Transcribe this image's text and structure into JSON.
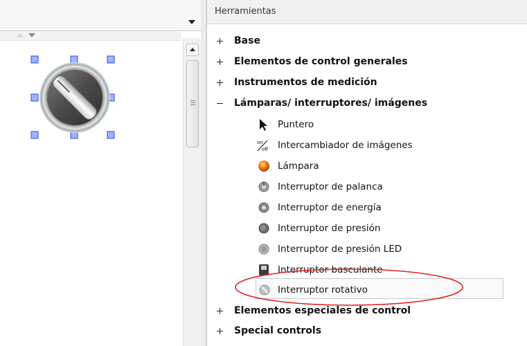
{
  "panel": {
    "title": "Herramientas"
  },
  "categories": {
    "base": "Base",
    "general_controls": "Elementos de control generales",
    "measuring_instruments": "Instrumentos de medición",
    "lamps_switches_images": "Lámparas/ interruptores/ imágenes",
    "special_controls_es": "Elementos especiales de control",
    "special_controls": "Special controls"
  },
  "tools": [
    {
      "label": "Puntero",
      "icon": "pointer-icon"
    },
    {
      "label": "Intercambiador de imágenes",
      "icon": "on-off-icon"
    },
    {
      "label": "Lámpara",
      "icon": "lamp-icon"
    },
    {
      "label": "Interruptor de palanca",
      "icon": "toggle-switch-icon"
    },
    {
      "label": "Interruptor de energía",
      "icon": "power-switch-icon"
    },
    {
      "label": "Interruptor de presión",
      "icon": "push-button-icon"
    },
    {
      "label": "Interruptor de presión LED",
      "icon": "led-push-button-icon"
    },
    {
      "label": "Interruptor basculante",
      "icon": "rocker-switch-icon"
    },
    {
      "label": "Interruptor rotativo",
      "icon": "rotary-switch-icon"
    }
  ],
  "on_off_glyph": {
    "top": "on",
    "bottom": "off"
  },
  "colors": {
    "selection_handle": "#2a4fd6",
    "highlight_ellipse": "#e02020",
    "lamp": "#f07a10"
  }
}
